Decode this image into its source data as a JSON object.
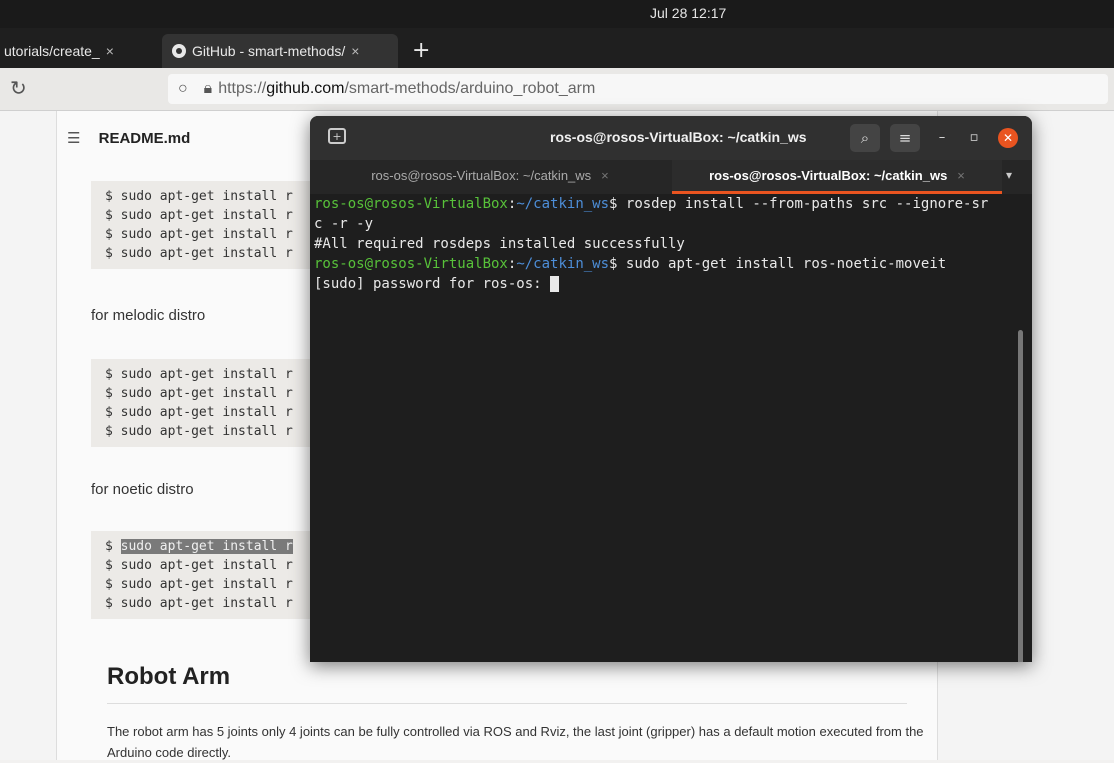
{
  "topbar": {
    "clock": "Jul 28  12:17"
  },
  "browser": {
    "tabs": [
      {
        "label": "utorials/create_"
      },
      {
        "label": "GitHub - smart-methods/"
      }
    ],
    "new_tab": "+",
    "reload_icon": "↻",
    "url_prefix": "https://",
    "url_host": "github.com",
    "url_path": "/smart-methods/arduino_robot_arm"
  },
  "page": {
    "readme_title": "README.md",
    "code_block_1": [
      "$ sudo apt-get install r",
      "$ sudo apt-get install r",
      "$ sudo apt-get install r",
      "$ sudo apt-get install r"
    ],
    "melodic_label": "for melodic distro",
    "code_block_2": [
      "$ sudo apt-get install r",
      "$ sudo apt-get install r",
      "$ sudo apt-get install r",
      "$ sudo apt-get install r"
    ],
    "noetic_label": "for noetic distro",
    "code_block_3": [
      {
        "dollar": "$",
        "cmd": "sudo apt-get install r"
      },
      {
        "dollar": "$",
        "cmd": "sudo apt-get install r"
      },
      {
        "dollar": "$",
        "cmd": "sudo apt-get install r"
      },
      {
        "dollar": "$",
        "cmd": "sudo apt-get install r"
      }
    ],
    "heading": "Robot Arm",
    "paragraph": "The robot arm has 5 joints only 4 joints can be fully controlled via ROS and Rviz, the last joint (gripper) has a default motion executed from the Arduino code directly."
  },
  "terminal": {
    "title": "ros-os@rosos-VirtualBox: ~/catkin_ws",
    "tabs": [
      {
        "label": "ros-os@rosos-VirtualBox: ~/catkin_ws"
      },
      {
        "label": "ros-os@rosos-VirtualBox: ~/catkin_ws"
      }
    ],
    "close_glyph": "×",
    "menu_glyph": "▾",
    "lines": {
      "l1_user": "ros-os@rosos-VirtualBox",
      "l1_colon": ":",
      "l1_path": "~/catkin_ws",
      "l1_cmd": "$ rosdep install --from-paths src --ignore-sr",
      "l2": "c -r -y",
      "l3": "#All required rosdeps installed successfully",
      "l4_user": "ros-os@rosos-VirtualBox",
      "l4_colon": ":",
      "l4_path": "~/catkin_ws",
      "l4_cmd": "$ sudo apt-get install ros-noetic-moveit",
      "l5": "[sudo] password for ros-os: "
    }
  }
}
